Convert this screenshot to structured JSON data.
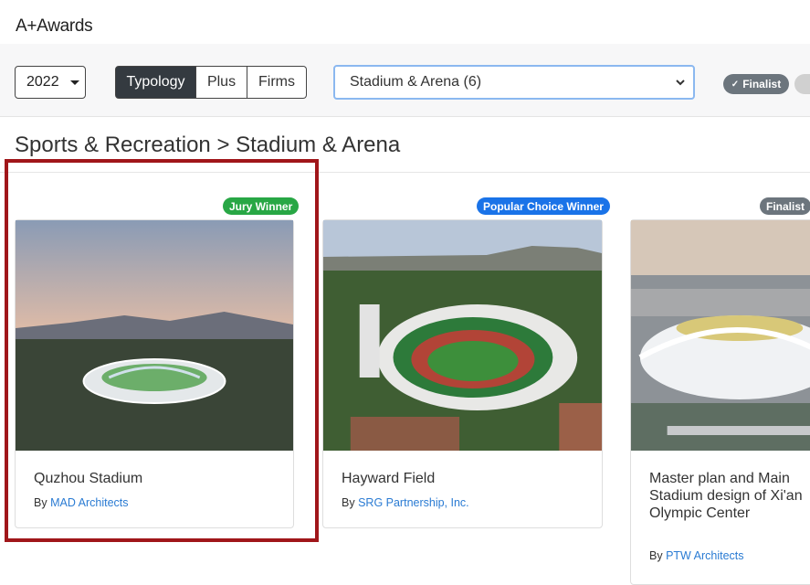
{
  "brand": "A+Awards",
  "filters": {
    "year": "2022",
    "segments": [
      "Typology",
      "Plus",
      "Firms"
    ],
    "category_select": "Stadium & Arena (6)",
    "status_pill": "Finalist"
  },
  "breadcrumb": "Sports & Recreation > Stadium & Arena",
  "colors": {
    "jury": "#28a745",
    "popular": "#1a73e8",
    "finalist": "#6c757d",
    "link": "#2a7bd3",
    "highlight": "#a0161a"
  },
  "cards": [
    {
      "badge": "Jury Winner",
      "title": "Quzhou Stadium",
      "by": "By",
      "firm": "MAD Architects"
    },
    {
      "badge": "Popular Choice Winner",
      "title": "Hayward Field",
      "by": "By",
      "firm": "SRG Partnership, Inc."
    },
    {
      "badge": "Finalist",
      "title": "Master plan and Main Stadium design of Xi'an Olympic Center",
      "by": "By",
      "firm": "PTW Architects"
    }
  ]
}
